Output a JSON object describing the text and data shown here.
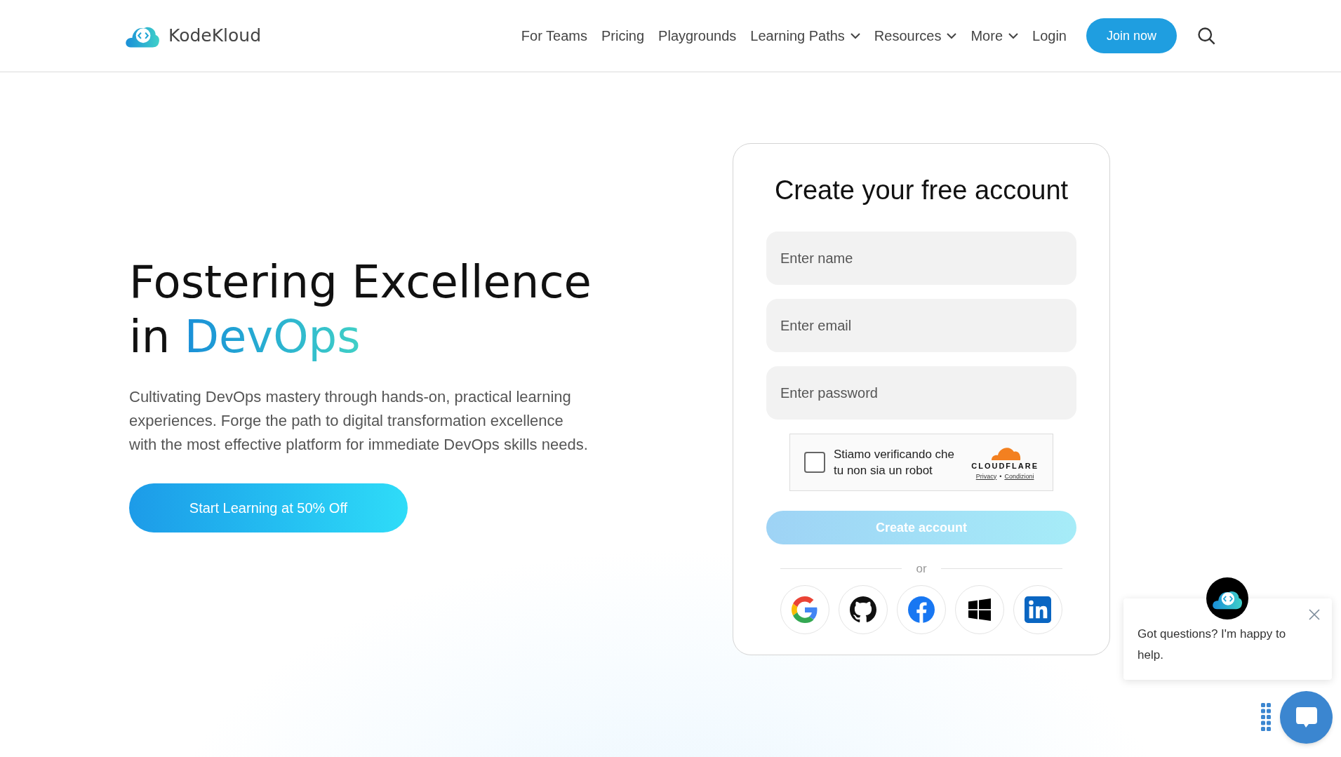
{
  "header": {
    "logo_text": "KodeKloud",
    "nav": [
      {
        "label": "For Teams",
        "has_dropdown": false
      },
      {
        "label": "Pricing",
        "has_dropdown": false
      },
      {
        "label": "Playgrounds",
        "has_dropdown": false
      },
      {
        "label": "Learning Paths",
        "has_dropdown": true
      },
      {
        "label": "Resources",
        "has_dropdown": true
      },
      {
        "label": "More",
        "has_dropdown": true
      },
      {
        "label": "Login",
        "has_dropdown": false
      }
    ],
    "cta": "Join now"
  },
  "hero": {
    "heading_line1": "Fostering Excellence",
    "heading_line2_prefix": "in",
    "heading_highlight": "DevOps",
    "description": "Cultivating DevOps mastery through hands-on, practical learning experiences. Forge the path to digital transformation excellence with the most effective platform for immediate DevOps skills needs.",
    "button": "Start Learning at 50% Off"
  },
  "signup": {
    "title": "Create your free account",
    "fields": [
      {
        "placeholder": "Enter name"
      },
      {
        "placeholder": "Enter email"
      },
      {
        "placeholder": "Enter password"
      }
    ],
    "captcha": {
      "checked": false,
      "text": "Stiamo verificando che tu non sia un robot",
      "brand": "CLOUDFLARE",
      "privacy": "Privacy",
      "separator": "•",
      "terms": "Condizioni"
    },
    "submit": {
      "label": "Create account",
      "disabled": true
    },
    "divider": "or",
    "socials": [
      {
        "kind": "google"
      },
      {
        "kind": "github"
      },
      {
        "kind": "facebook"
      },
      {
        "kind": "windows"
      },
      {
        "kind": "linkedin"
      }
    ]
  },
  "chat": {
    "message": "Got questions? I'm happy to help."
  }
}
